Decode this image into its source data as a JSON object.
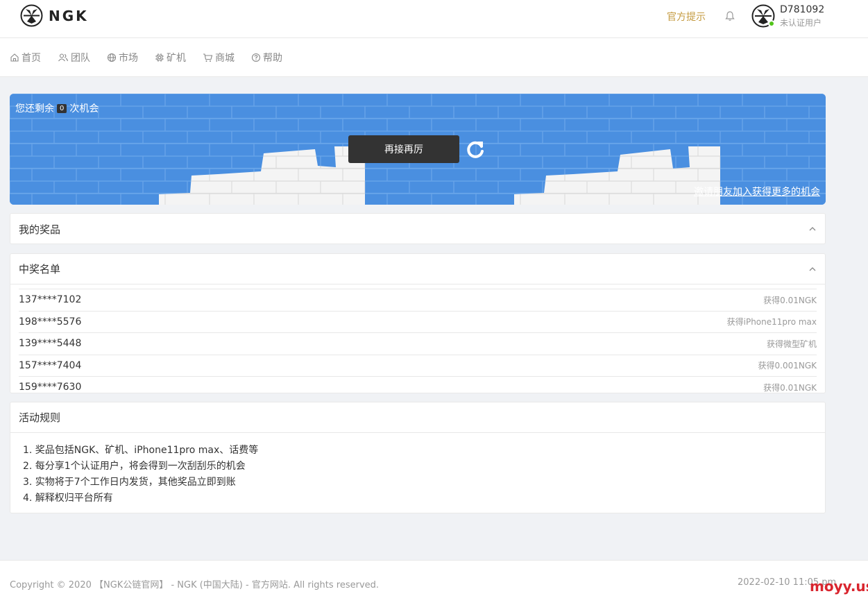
{
  "header": {
    "logo_text": "NGK",
    "notice_label": "官方提示",
    "user": {
      "id": "D781092",
      "status": "未认证用户"
    }
  },
  "nav": [
    {
      "label": "首页",
      "icon": "home-icon"
    },
    {
      "label": "团队",
      "icon": "team-icon"
    },
    {
      "label": "市场",
      "icon": "globe-icon"
    },
    {
      "label": "矿机",
      "icon": "chip-icon"
    },
    {
      "label": "商城",
      "icon": "cart-icon"
    },
    {
      "label": "帮助",
      "icon": "help-icon"
    }
  ],
  "banner": {
    "prefix": "您还剩余",
    "count": "0",
    "suffix": "次机会",
    "retry_label": "再接再厉",
    "invite_link": "邀请朋友加入获得更多的机会"
  },
  "my_prizes": {
    "title": "我的奖品"
  },
  "winners": {
    "title": "中奖名单",
    "rows": [
      {
        "phone": "137****7102",
        "prize": "获得0.01NGK"
      },
      {
        "phone": "198****5576",
        "prize": "获得iPhone11pro max"
      },
      {
        "phone": "139****5448",
        "prize": "获得微型矿机"
      },
      {
        "phone": "157****7404",
        "prize": "获得0.001NGK"
      },
      {
        "phone": "159****7630",
        "prize": "获得0.01NGK"
      }
    ]
  },
  "rules": {
    "title": "活动规则",
    "items": [
      "1. 奖品包括NGK、矿机、iPhone11pro max、话费等",
      "2. 每分享1个认证用户，将会得到一次刮刮乐的机会",
      "3. 实物将于7个工作日内发货，其他奖品立即到账",
      "4. 解释权归平台所有"
    ]
  },
  "footer": {
    "copyright": "Copyright © 2020 【NGK公链官网】 - NGK (中国大陆) - 官方网站. All rights reserved.",
    "date": "2022-02-10 11:05 pm"
  },
  "watermark": "moyy.us",
  "colors": {
    "accent": "#c49a3f",
    "banner_blue": "#4a8fe0",
    "online": "#52c41a",
    "watermark": "#d9252e"
  }
}
